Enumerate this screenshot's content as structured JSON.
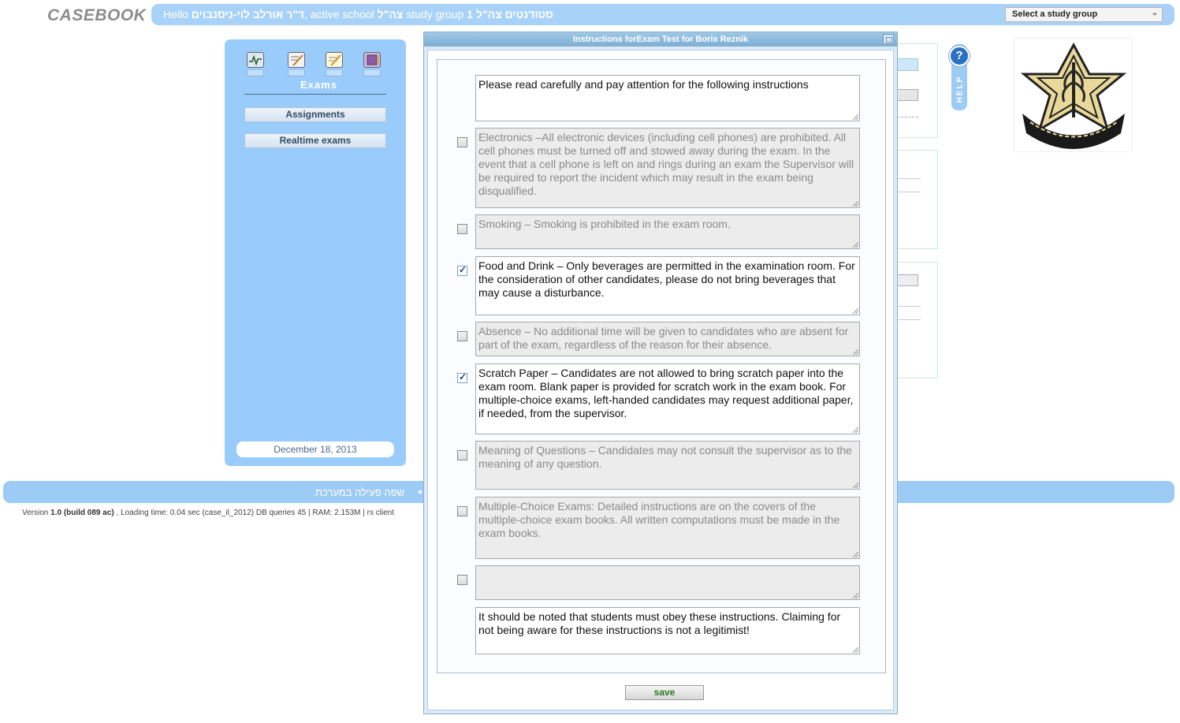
{
  "app": {
    "logo": "CASEBOOK",
    "greeting_hello": "Hello",
    "greeting_user": "ד\"ר אורלב לוי-ניסנבוים",
    "greeting_school_prefix": ", active school",
    "greeting_school": "צה\"ל",
    "greeting_group_prefix": "study group",
    "greeting_group": "1 סטודנטים צה\"ל",
    "study_group_select": "Select a study group"
  },
  "sidebar": {
    "icons": [
      "monitor-icon",
      "edit-notes-icon",
      "exam-notepad-icon",
      "book-icon"
    ],
    "section_title": "Exams",
    "buttons": [
      {
        "label": "Assignments"
      },
      {
        "label": "Realtime exams"
      }
    ],
    "date": "December 18, 2013"
  },
  "help": {
    "icon_label": "?",
    "tab_label": "HELP"
  },
  "footer": {
    "language_label": "שפה פעילה במערכת",
    "version_prefix": "Version",
    "version_number": "1.0 (build 089 ac)",
    "version_details": ", Loading time: 0.04 sec  (case_il_2012) DB queries 45 | RAM: 2.153M | rs client"
  },
  "modal": {
    "title": "Instructions forExam Test for Boris Reznik",
    "intro": "Please read carefully and pay attention for the following instructions",
    "rules": [
      {
        "text": "Electronics –All electronic devices (including cell phones) are prohibited. All cell phones must be turned off and stowed away during the exam. In the event that a cell phone is left on and rings during an exam the Supervisor will be required to report the incident which may result in the exam being disqualified.",
        "checked": false
      },
      {
        "text": "Smoking – Smoking is prohibited in the exam room.",
        "checked": false
      },
      {
        "text": "Food and Drink – Only beverages are permitted in the examination room. For the  consideration of other candidates, please do not bring beverages that may cause a disturbance.",
        "checked": true
      },
      {
        "text": "Absence – No additional time will be given to candidates who are absent for part of the exam, regardless of the reason for their absence.",
        "checked": false
      },
      {
        "text": "Scratch Paper – Candidates are not allowed to bring scratch paper into the exam room. Blank paper is provided for scratch work in the exam book. For multiple-choice exams, left-handed candidates may request additional paper, if needed, from the supervisor.",
        "checked": true
      },
      {
        "text": "Meaning of Questions – Candidates may not consult the supervisor as to the meaning of any question.",
        "checked": false
      },
      {
        "text": "Multiple-Choice Exams: Detailed instructions are on the covers of the multiple-choice exam books. All written computations must be made in the exam books.",
        "checked": false
      },
      {
        "text": "",
        "checked": false
      }
    ],
    "closing": "It should be noted that students must obey these instructions. Claiming for not being aware for these instructions is not a legitimist!",
    "save_label": "save"
  },
  "colors": {
    "bar_blue": "#a9d2f8",
    "panel_blue": "#99ccfb",
    "save_green": "#2a7a1e"
  }
}
